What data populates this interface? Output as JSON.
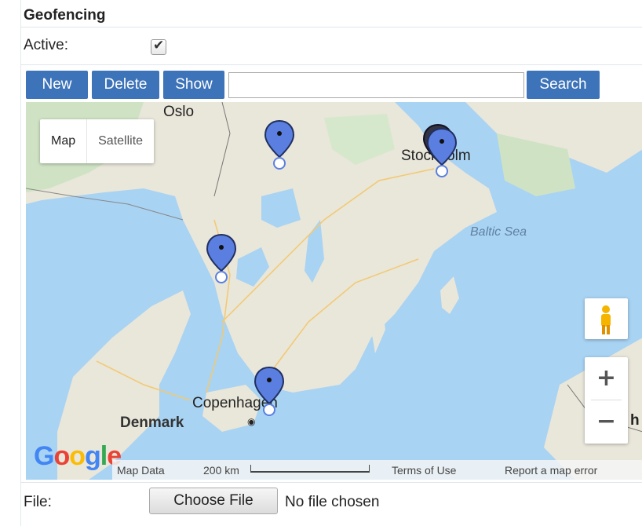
{
  "panel": {
    "title": "Geofencing",
    "active_label": "Active:",
    "active_checked": true
  },
  "toolbar": {
    "new_label": "New",
    "delete_label": "Delete",
    "show_label": "Show",
    "search_value": "",
    "search_label": "Search",
    "button_color": "#3d73b8"
  },
  "map": {
    "maptype_map": "Map",
    "maptype_satellite": "Satellite",
    "labels": {
      "oslo": "Oslo",
      "stockholm": "Stockholm",
      "baltic_sea": "Baltic Sea",
      "copenhagen": "Copenhagen",
      "denmark": "Denmark",
      "partial_right": "h"
    },
    "zoom_in": "+",
    "zoom_out": "−",
    "pegman_icon": "pegman-icon",
    "marker_color": "#5b7fe0",
    "water_color": "#a8d3f3",
    "land_color": "#e9e6da",
    "attribution": {
      "google": "Google",
      "map_data": "Map Data",
      "scale": "200 km",
      "terms": "Terms of Use",
      "report": "Report a map error"
    }
  },
  "file": {
    "label": "File:",
    "choose_label": "Choose File",
    "status": "No file chosen"
  }
}
